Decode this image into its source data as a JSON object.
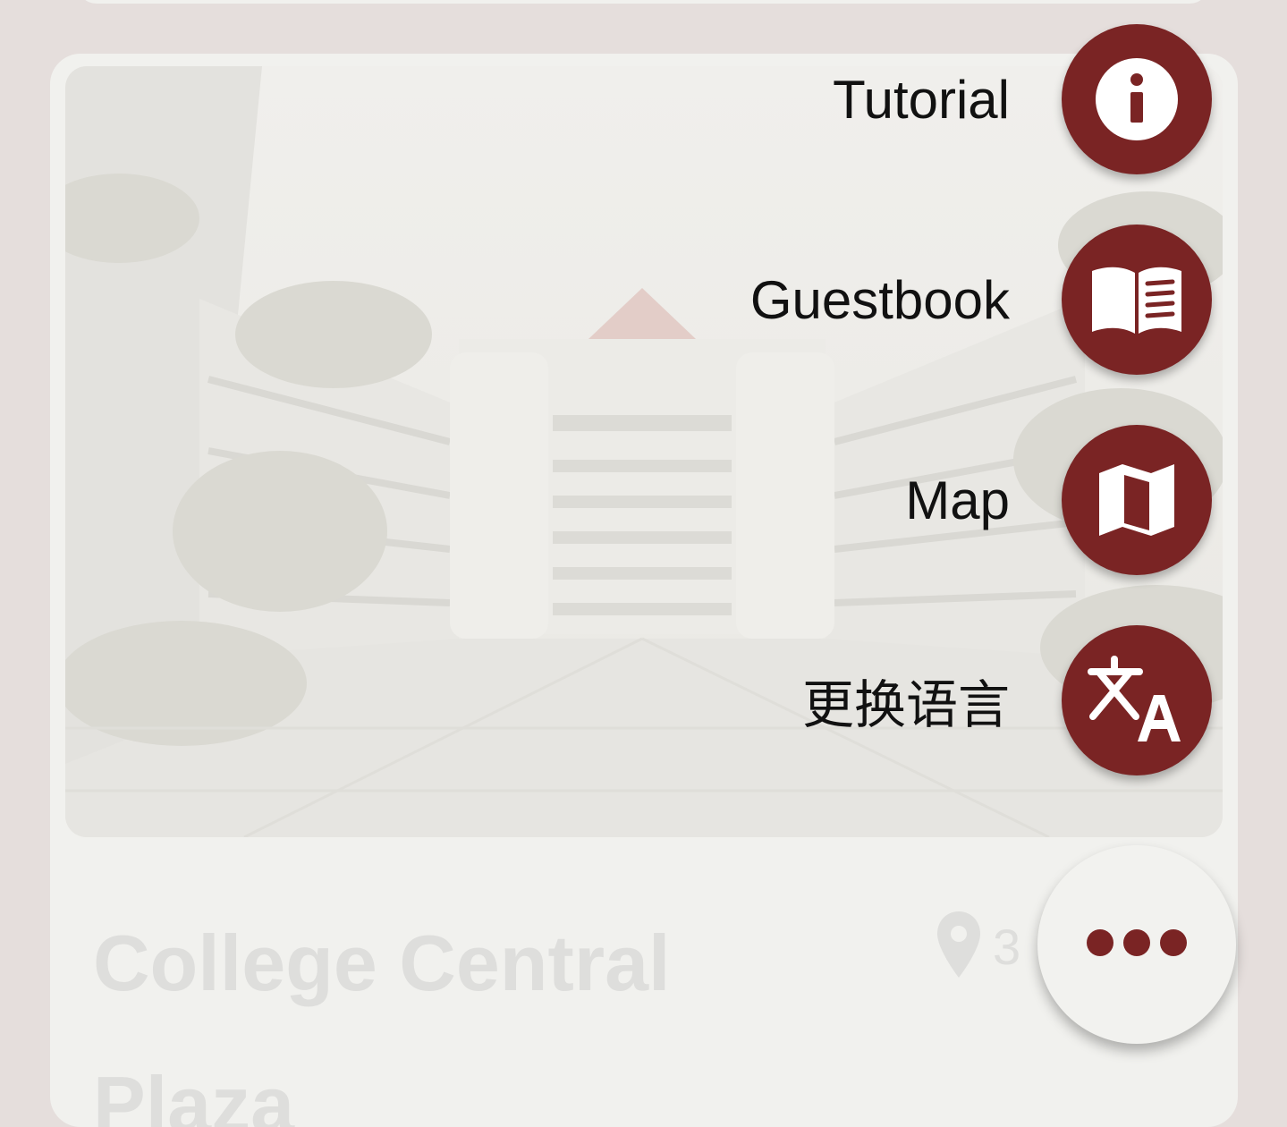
{
  "card": {
    "title": "College Central Plaza",
    "distance": "3"
  },
  "speed_dial": {
    "items": [
      {
        "label": "Tutorial",
        "icon": "info-icon"
      },
      {
        "label": "Guestbook",
        "icon": "book-icon"
      },
      {
        "label": "Map",
        "icon": "map-icon"
      },
      {
        "label": "更换语言",
        "icon": "translate-icon"
      }
    ],
    "toggle_icon": "more-horizontal-icon"
  },
  "colors": {
    "accent": "#7a2424",
    "background": "#e5dedc",
    "card": "#f1f1ee"
  }
}
